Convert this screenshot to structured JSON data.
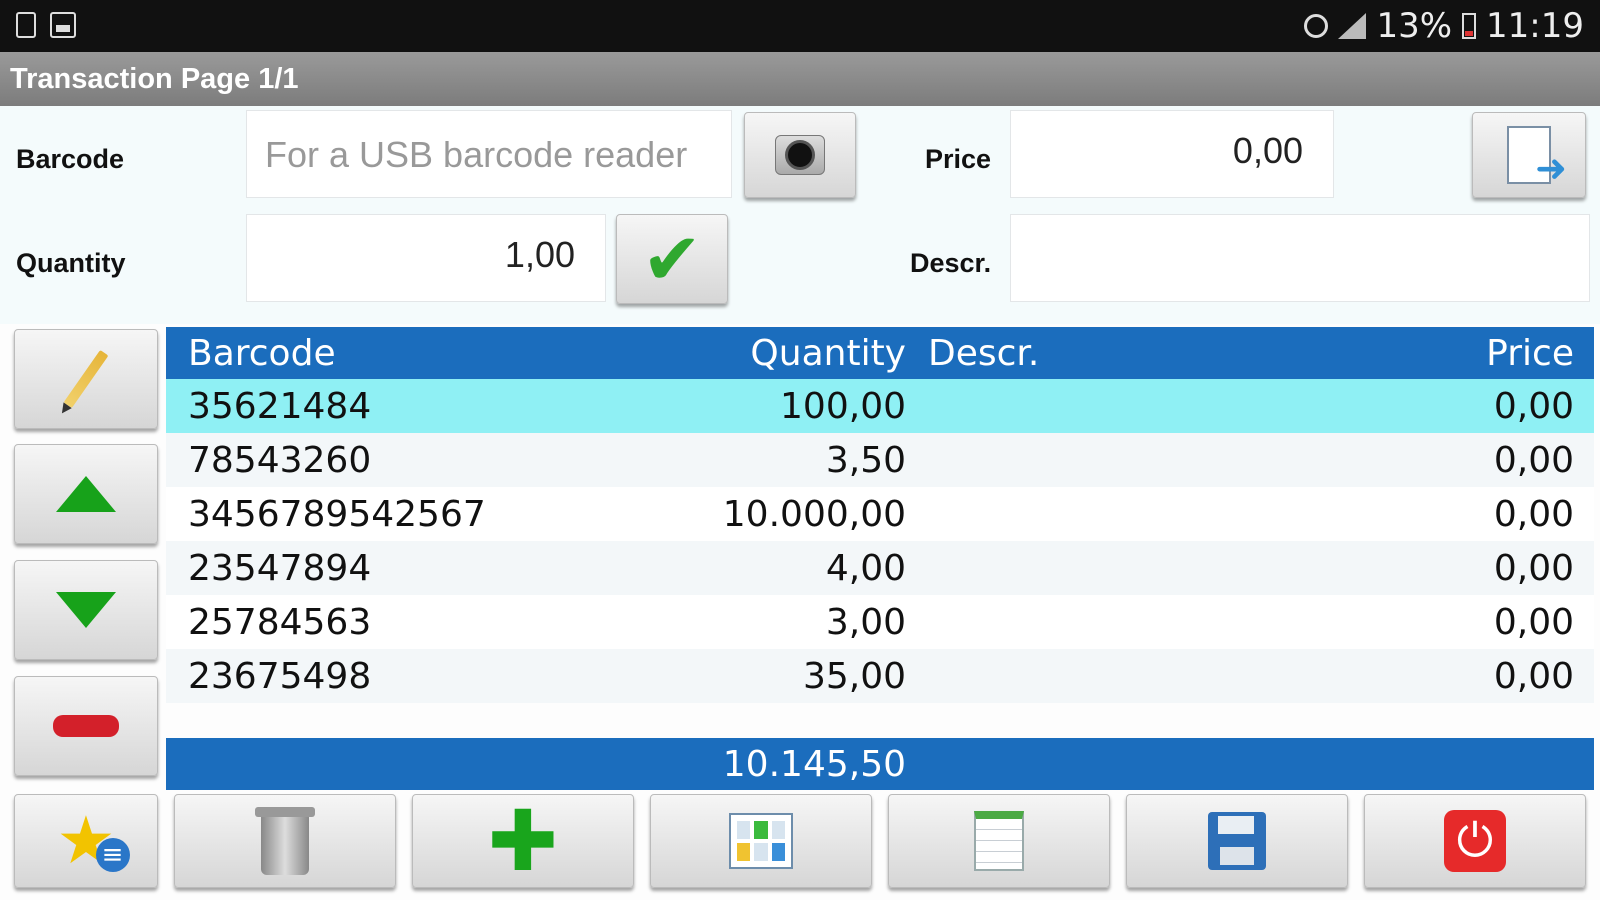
{
  "status_bar": {
    "battery_percent": "13%",
    "time": "11:19"
  },
  "title": "Transaction Page 1/1",
  "form": {
    "barcode_label": "Barcode",
    "barcode_placeholder": "For a USB barcode reader",
    "price_label": "Price",
    "price_value": "0,00",
    "quantity_label": "Quantity",
    "quantity_value": "1,00",
    "descr_label": "Descr.",
    "descr_value": ""
  },
  "table": {
    "headers": {
      "barcode": "Barcode",
      "quantity": "Quantity",
      "descr": "Descr.",
      "price": "Price"
    },
    "rows": [
      {
        "barcode": "35621484",
        "quantity": "100,00",
        "descr": "",
        "price": "0,00"
      },
      {
        "barcode": "78543260",
        "quantity": "3,50",
        "descr": "",
        "price": "0,00"
      },
      {
        "barcode": "3456789542567",
        "quantity": "10.000,00",
        "descr": "",
        "price": "0,00"
      },
      {
        "barcode": "23547894",
        "quantity": "4,00",
        "descr": "",
        "price": "0,00"
      },
      {
        "barcode": "25784563",
        "quantity": "3,00",
        "descr": "",
        "price": "0,00"
      },
      {
        "barcode": "23675498",
        "quantity": "35,00",
        "descr": "",
        "price": "0,00"
      }
    ],
    "selected_row": 0,
    "total_quantity": "10.145,50"
  },
  "icons": {
    "camera": "camera-icon",
    "confirm": "checkmark-icon",
    "export": "document-export-icon",
    "edit": "pencil-icon",
    "up": "arrow-up-icon",
    "down": "arrow-down-icon",
    "remove": "minus-icon",
    "favorites": "star-list-icon",
    "delete": "trash-icon",
    "add": "plus-icon",
    "layout": "grid-icon",
    "sheet": "spreadsheet-icon",
    "save": "floppy-icon",
    "exit": "power-icon"
  },
  "colors": {
    "header_blue": "#1b6dbd",
    "selected_row": "#8ff0f4",
    "title_bar": "#8a8a8a"
  }
}
